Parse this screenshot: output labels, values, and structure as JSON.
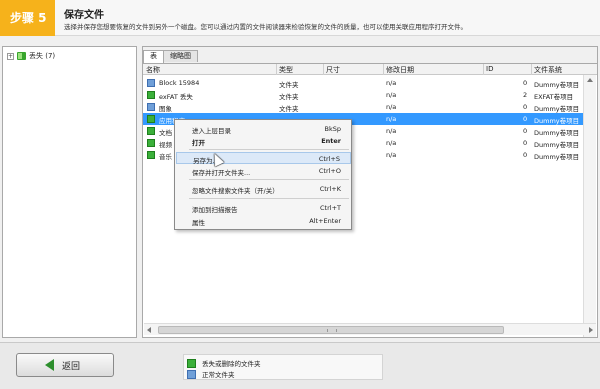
{
  "header": {
    "step": "步骤 5",
    "title": "保存文件",
    "subtitle": "选择并保存您想要恢复的文件到另外一个磁盘。您可以通过内置的文件阅读器来检验恢复的文件的质量，也可以使用关联应用程序打开文件。",
    "accent_color": "#f6b21b"
  },
  "tree": {
    "expander": "+",
    "root_label": "丢失 (7)"
  },
  "tabs": [
    "表",
    "缩略图"
  ],
  "columns": [
    "名称",
    "类型",
    "尺寸",
    "修改日期",
    "ID",
    "文件系统"
  ],
  "rows": [
    {
      "name": "Block 15984",
      "type": "文件夹",
      "size": "",
      "date": "n/a",
      "id": "0",
      "fs": "Dummy卷项目",
      "icon": "folder-blue"
    },
    {
      "name": "exFAT 丢失",
      "type": "文件夹",
      "size": "",
      "date": "n/a",
      "id": "2",
      "fs": "EXFAT卷项目",
      "icon": "folder-green"
    },
    {
      "name": "图象",
      "type": "文件夹",
      "size": "",
      "date": "n/a",
      "id": "0",
      "fs": "Dummy卷项目",
      "icon": "folder-blue"
    },
    {
      "name": "应用程序",
      "type": "",
      "size": "",
      "date": "n/a",
      "id": "0",
      "fs": "Dummy卷项目",
      "icon": "folder-green",
      "selected": true
    },
    {
      "name": "文档",
      "type": "",
      "size": "",
      "date": "n/a",
      "id": "0",
      "fs": "Dummy卷项目",
      "icon": "folder-green"
    },
    {
      "name": "视频",
      "type": "",
      "size": "",
      "date": "n/a",
      "id": "0",
      "fs": "Dummy卷项目",
      "icon": "folder-green"
    },
    {
      "name": "音乐",
      "type": "",
      "size": "",
      "date": "n/a",
      "id": "0",
      "fs": "Dummy卷项目",
      "icon": "folder-green"
    }
  ],
  "context_menu": [
    {
      "label": "进入上层目录",
      "key": "BkSp"
    },
    {
      "label": "打开",
      "key": "Enter",
      "bold": true
    },
    {
      "label": "另存为...",
      "key": "Ctrl+S",
      "hover": true
    },
    {
      "label": "保存并打开文件夹...",
      "key": "Ctrl+O"
    },
    {
      "label": "忽略文件搜索文件夹（开/关）",
      "key": "Ctrl+K"
    },
    {
      "label": "添加到扫描报告",
      "key": "Ctrl+T"
    },
    {
      "label": "属性",
      "key": "Alt+Enter"
    }
  ],
  "footer": {
    "back_label": "返回",
    "legend": [
      {
        "label": "丢失或删除的文件夹",
        "icon": "folder-green"
      },
      {
        "label": "正常文件夹",
        "icon": "folder-blue"
      }
    ]
  }
}
